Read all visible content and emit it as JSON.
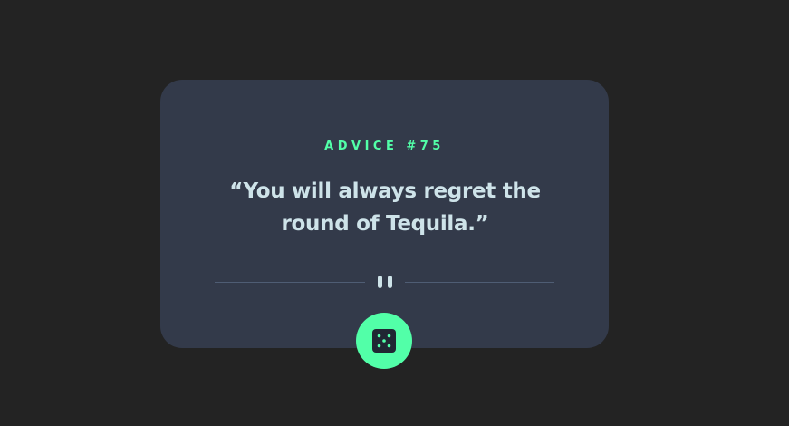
{
  "advice": {
    "label": "ADVICE #75",
    "quote": "“You will always regret the round of Tequila.”"
  },
  "icons": {
    "divider": "pause-icon",
    "button": "dice-icon"
  },
  "colors": {
    "background": "#232323",
    "card": "#333a4a",
    "accent": "#52ffa8",
    "text": "#cee3e9",
    "divider": "#4f5d74"
  }
}
